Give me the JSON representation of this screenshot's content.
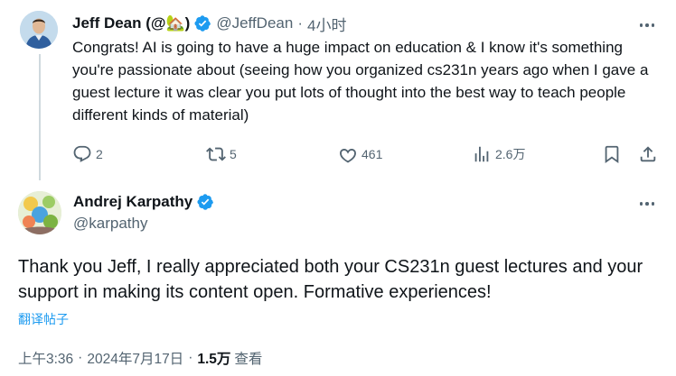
{
  "reply_tweet": {
    "author_name": "Jeff Dean (@🏡)",
    "handle": "@JeffDean",
    "separator": "·",
    "time": "4小时",
    "text": "Congrats! AI is going to have a huge impact on education & I know it's something you're passionate about (seeing how you organized cs231n years ago when I gave a guest lecture it was clear you put lots of thought into the best way to teach people different kinds of material)",
    "actions": {
      "reply_count": "2",
      "retweet_count": "5",
      "like_count": "461",
      "view_count": "2.6万"
    }
  },
  "main_tweet": {
    "author_name": "Andrej Karpathy",
    "handle": "@karpathy",
    "text": "Thank you Jeff, I really appreciated both your CS231n guest lectures and your support in making its content open. Formative experiences!",
    "translate_label": "翻译帖子",
    "meta": {
      "time": "上午3:36",
      "separator": "·",
      "date": "2024年7月17日",
      "views_count": "1.5万",
      "views_label": "查看"
    }
  },
  "icons": {
    "verified": "verified-badge-icon",
    "more": "more-icon",
    "reply": "reply-icon",
    "retweet": "retweet-icon",
    "like": "heart-icon",
    "views": "views-icon",
    "bookmark": "bookmark-icon",
    "share": "share-icon"
  },
  "colors": {
    "verified": "#1d9bf0",
    "link": "#1d9bf0",
    "secondary_text": "#536471",
    "primary_text": "#0f1419"
  }
}
